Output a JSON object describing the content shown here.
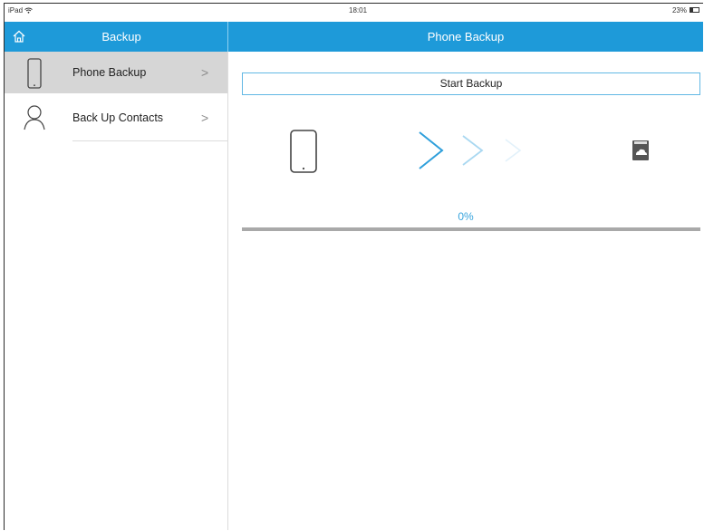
{
  "status_bar": {
    "device": "iPad",
    "time": "18:01",
    "battery": "23%"
  },
  "nav": {
    "left_title": "Backup",
    "right_title": "Phone Backup"
  },
  "sidebar": {
    "items": [
      {
        "label": "Phone Backup",
        "icon": "phone-icon",
        "selected": true
      },
      {
        "label": "Back Up Contacts",
        "icon": "person-icon",
        "selected": false
      }
    ]
  },
  "main": {
    "start_button_label": "Start Backup",
    "progress_text": "0%",
    "progress_value": 0
  },
  "colors": {
    "accent": "#1e9ad9",
    "selected_row": "#d6d6d6",
    "progress_track": "#a9a9a9",
    "percent_text": "#3aa5dd"
  }
}
